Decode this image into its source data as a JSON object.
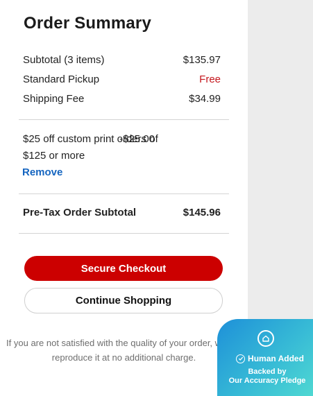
{
  "summary": {
    "title": "Order Summary",
    "subtotal_label": "Subtotal (3 items)",
    "subtotal_value": "$135.97",
    "pickup_label": "Standard Pickup",
    "pickup_value": "Free",
    "shipping_label": "Shipping Fee",
    "shipping_value": "$34.99",
    "promo_text": "$25 off custom print orders of $125 or more",
    "promo_value": "-$25.00",
    "remove_label": "Remove",
    "pretax_label": "Pre-Tax Order Subtotal",
    "pretax_value": "$145.96"
  },
  "actions": {
    "checkout_label": "Secure Checkout",
    "continue_label": "Continue Shopping"
  },
  "guarantee": {
    "text": "If you are not satisfied with the quality of your order, we will reproduce it at no additional charge."
  },
  "badge": {
    "icon": "house-shield-icon",
    "main": "Human Added",
    "sub_line1": "Backed by",
    "sub_line2": "Our Accuracy Pledge"
  },
  "colors": {
    "accent": "#cc0000",
    "link": "#1565c0",
    "badge_start": "#1e90d8",
    "badge_end": "#4fd8d2"
  }
}
